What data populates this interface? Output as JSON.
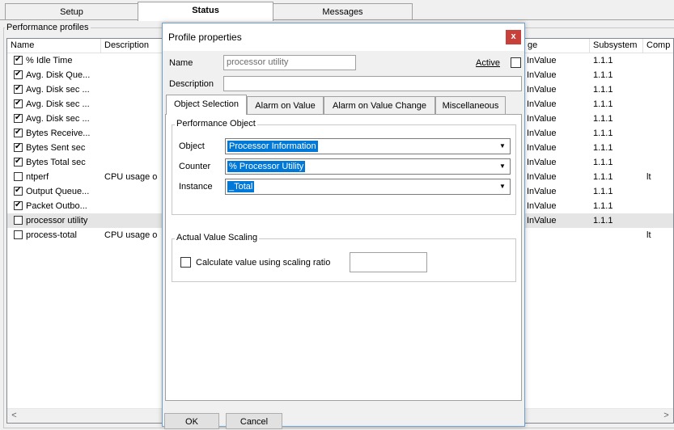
{
  "tabs": [
    {
      "label": "Setup",
      "active": false
    },
    {
      "label": "Status",
      "active": true
    },
    {
      "label": "Messages",
      "active": false
    }
  ],
  "group_label": "Performance profiles",
  "list": {
    "columns": [
      "Name",
      "Description",
      "ge",
      "Subsystem",
      "Comp"
    ],
    "rows": [
      {
        "checked": true,
        "name": "% Idle Time",
        "desc": "",
        "value": "InValue",
        "subsystem": "1.1.1",
        "comp": ""
      },
      {
        "checked": true,
        "name": "Avg. Disk Que...",
        "desc": "",
        "value": "InValue",
        "subsystem": "1.1.1",
        "comp": ""
      },
      {
        "checked": true,
        "name": "Avg. Disk sec ...",
        "desc": "",
        "value": "InValue",
        "subsystem": "1.1.1",
        "comp": ""
      },
      {
        "checked": true,
        "name": "Avg. Disk sec ...",
        "desc": "",
        "value": "InValue",
        "subsystem": "1.1.1",
        "comp": ""
      },
      {
        "checked": true,
        "name": "Avg. Disk sec ...",
        "desc": "",
        "value": "InValue",
        "subsystem": "1.1.1",
        "comp": ""
      },
      {
        "checked": true,
        "name": "Bytes Receive...",
        "desc": "",
        "value": "InValue",
        "subsystem": "1.1.1",
        "comp": ""
      },
      {
        "checked": true,
        "name": "Bytes Sent sec",
        "desc": "",
        "value": "InValue",
        "subsystem": "1.1.1",
        "comp": ""
      },
      {
        "checked": true,
        "name": "Bytes Total sec",
        "desc": "",
        "value": "InValue",
        "subsystem": "1.1.1",
        "comp": ""
      },
      {
        "checked": false,
        "name": "ntperf",
        "desc": "CPU usage o",
        "value": "InValue",
        "subsystem": "1.1.1",
        "comp": "lt"
      },
      {
        "checked": true,
        "name": "Output Queue...",
        "desc": "",
        "value": "InValue",
        "subsystem": "1.1.1",
        "comp": ""
      },
      {
        "checked": true,
        "name": "Packet Outbo...",
        "desc": "",
        "value": "InValue",
        "subsystem": "1.1.1",
        "comp": ""
      },
      {
        "checked": false,
        "name": "processor utility",
        "desc": "",
        "value": "InValue",
        "subsystem": "1.1.1",
        "comp": "",
        "selected": true
      },
      {
        "checked": false,
        "name": "process-total",
        "desc": "CPU usage o",
        "value": "",
        "subsystem": "",
        "comp": "lt"
      }
    ]
  },
  "scroll": {
    "left_arrow": "<",
    "right_arrow": ">"
  },
  "dialog": {
    "title": "Profile properties",
    "close": "x",
    "name_label": "Name",
    "name_value": "processor utility",
    "active_label": "Active",
    "description_label": "Description",
    "description_value": "",
    "subtabs": [
      "Object Selection",
      "Alarm on Value",
      "Alarm on Value Change",
      "Miscellaneous"
    ],
    "perf_group": "Performance Object",
    "object_label": "Object",
    "object_value": "Processor Information",
    "counter_label": "Counter",
    "counter_value": "% Processor Utility",
    "instance_label": "Instance",
    "instance_value": "_Total",
    "scaling_group": "Actual Value Scaling",
    "scaling_label": "Calculate value using scaling ratio",
    "scaling_value": "",
    "ok": "OK",
    "cancel": "Cancel"
  },
  "colors": {
    "selection": "#0078d7",
    "close_button": "#c7403a",
    "dialog_border": "#6d9fd1"
  }
}
